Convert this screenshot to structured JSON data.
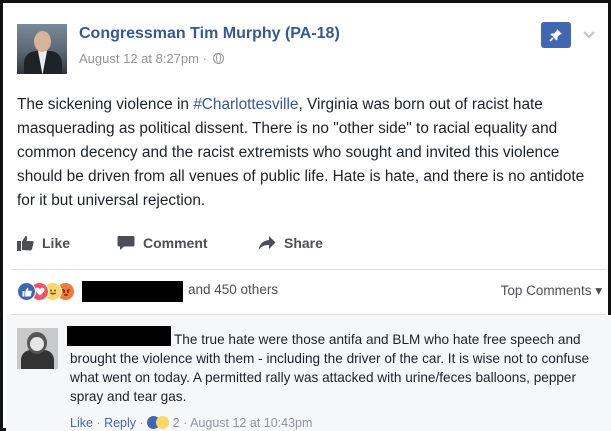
{
  "post": {
    "page_name": "Congressman Tim Murphy (PA-18)",
    "timestamp": "August 12 at 8:27pm",
    "separator": "·",
    "text_before": "The sickening violence in ",
    "hashtag": "#Charlottesville",
    "text_after": ", Virginia was born out of racist hate masquerading as political dissent. There is no \"other side\" to racial equality and common decency and the racist extremists who sought and invited this violence should be driven from all venues of public life. Hate is hate, and there is no antidote for it but universal rejection."
  },
  "actions": {
    "like_label": "Like",
    "comment_label": "Comment",
    "share_label": "Share"
  },
  "reactions": {
    "others_label": "and 450 others",
    "top_comments_label": "Top Comments",
    "top_comments_arrow": "▾",
    "icons": [
      "like-icon",
      "love-icon",
      "haha-icon",
      "angry-icon"
    ]
  },
  "comment": {
    "text": "The true hate were those antifa and BLM who hate free speech and brought the violence with them - including the driver of the car. It is wise not to confuse what went on today. A permitted rally was attacked with urine/feces balloons, pepper spray and tear gas.",
    "like_label": "Like",
    "reply_label": "Reply",
    "separator": "·",
    "reaction_count": "2",
    "timestamp": "August 12 at 10:43pm"
  },
  "colors": {
    "brand_blue": "#4267b2",
    "link_blue": "#365899",
    "meta_gray": "#90949c",
    "text_dark": "#1d2129"
  }
}
